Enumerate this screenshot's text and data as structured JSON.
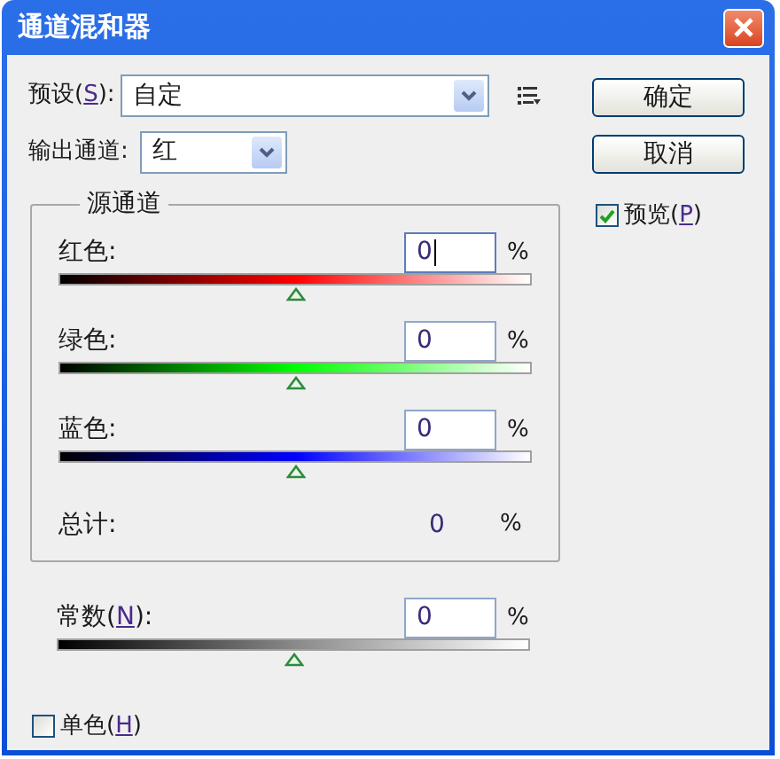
{
  "window": {
    "title": "通道混和器"
  },
  "preset": {
    "label_before": "预设(",
    "mnemonic": "S",
    "label_after": "):",
    "value": "自定"
  },
  "output_channel": {
    "label": "输出通道:",
    "value": "红"
  },
  "buttons": [
    {
      "label": "确定"
    },
    {
      "label": "取消"
    }
  ],
  "preview": {
    "label_before": "预览(",
    "mnemonic": "P",
    "label_after": ")",
    "checked": true
  },
  "source_channels": {
    "title": "源通道",
    "channels": [
      {
        "label": "红色:",
        "value": "0",
        "unit": "%",
        "focused": true,
        "kind": "red",
        "level": 0.5
      },
      {
        "label": "绿色:",
        "value": "0",
        "unit": "%",
        "focused": false,
        "kind": "green",
        "level": 0.5
      },
      {
        "label": "蓝色:",
        "value": "0",
        "unit": "%",
        "focused": false,
        "kind": "blue",
        "level": 0.5
      }
    ],
    "total": {
      "label": "总计:",
      "value": "0",
      "unit": "%"
    }
  },
  "constant": {
    "label_before": "常数(",
    "mnemonic": "N",
    "label_after": "):",
    "value": "0",
    "unit": "%",
    "focused": false,
    "level": 0.5
  },
  "monochrome": {
    "label_before": "单色(",
    "mnemonic": "H",
    "label_after": ")",
    "checked": false
  }
}
